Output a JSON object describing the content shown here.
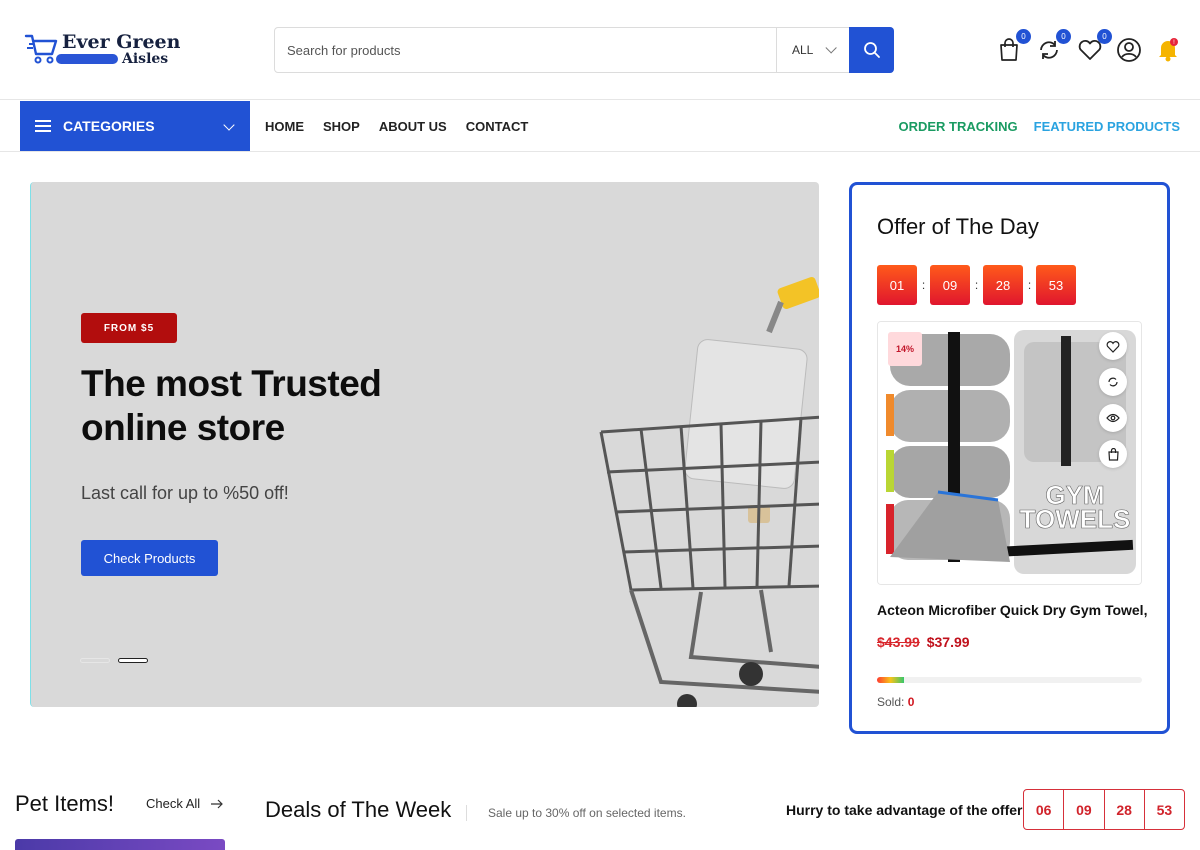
{
  "brand": {
    "line1": "Ever Green",
    "line2": "Aisles",
    "accent": "#2152d4"
  },
  "search": {
    "placeholder": "Search for products",
    "category": "ALL"
  },
  "header_icons": [
    {
      "name": "cart-icon",
      "badge": "0"
    },
    {
      "name": "compare-icon",
      "badge": "0"
    },
    {
      "name": "wishlist-icon",
      "badge": "0"
    },
    {
      "name": "account-icon"
    },
    {
      "name": "notification-icon"
    }
  ],
  "nav": {
    "categories_label": "CATEGORIES",
    "menu": [
      "HOME",
      "SHOP",
      "ABOUT US",
      "CONTACT"
    ],
    "order_tracking": "ORDER TRACKING",
    "featured_products": "FEATURED PRODUCTS"
  },
  "hero": {
    "badge": "FROM $5",
    "title": "The most Trusted online store",
    "subtitle": "Last call for up to %50 off!",
    "button": "Check Products",
    "slides": 2,
    "active_slide": 2
  },
  "offer": {
    "title": "Offer of The Day",
    "timer": [
      "01",
      "09",
      "28",
      "53"
    ],
    "discount": "14%",
    "product_name": "Acteon Microfiber Quick Dry Gym Towel,",
    "old_price": "$43.99",
    "new_price": "$37.99",
    "sold_label": "Sold:",
    "sold_value": "0",
    "product_image_text": "GYM TOWELS"
  },
  "pet": {
    "title": "Pet Items!",
    "check_all": "Check All"
  },
  "deals": {
    "title": "Deals of The Week",
    "subtitle": "Sale up to 30% off on selected items.",
    "hurry": "Hurry to take advantage of the offer",
    "timer": [
      "06",
      "09",
      "28",
      "53"
    ]
  }
}
